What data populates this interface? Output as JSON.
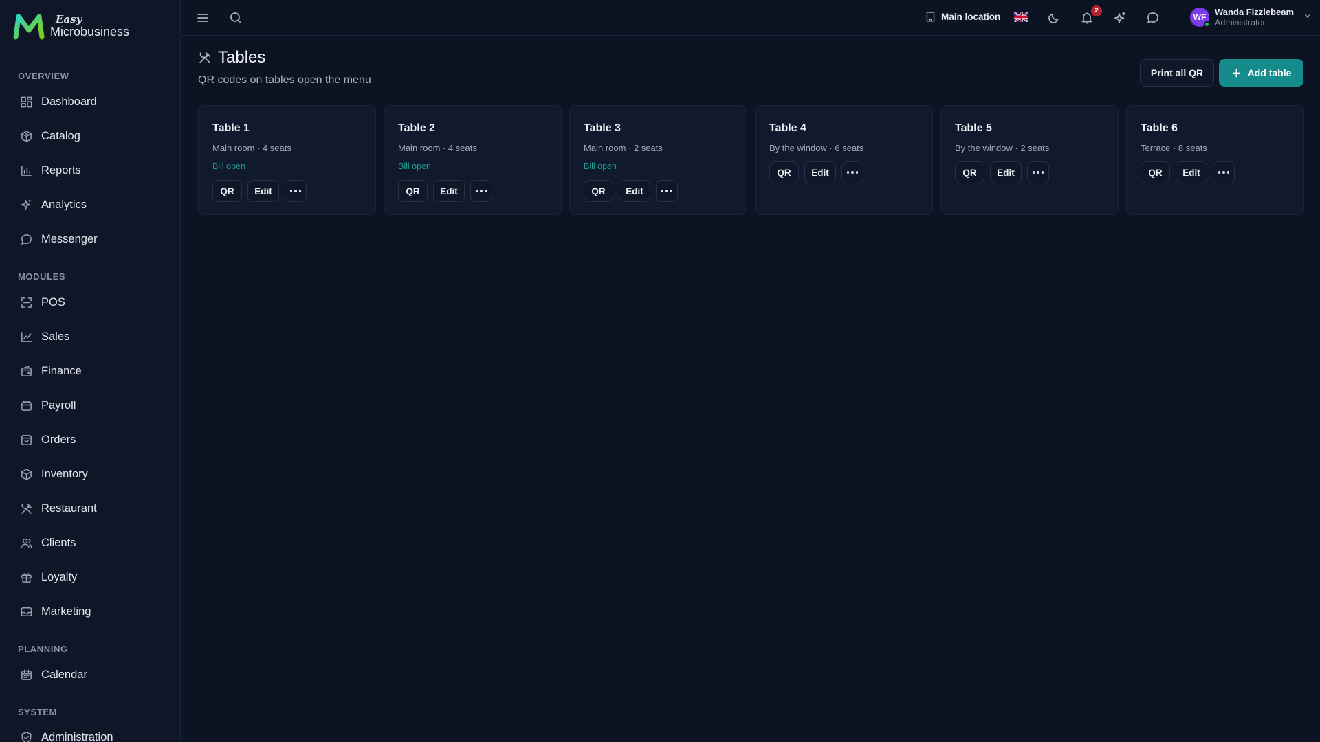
{
  "brand": {
    "easy": "Easy",
    "name": "Microbusiness"
  },
  "sidebar": {
    "sections": [
      {
        "label": "OVERVIEW",
        "items": [
          {
            "label": "Dashboard",
            "icon": "dashboard-icon"
          },
          {
            "label": "Catalog",
            "icon": "catalog-icon"
          },
          {
            "label": "Reports",
            "icon": "reports-icon"
          },
          {
            "label": "Analytics",
            "icon": "analytics-icon"
          },
          {
            "label": "Messenger",
            "icon": "messenger-icon"
          }
        ]
      },
      {
        "label": "MODULES",
        "items": [
          {
            "label": "POS",
            "icon": "pos-icon"
          },
          {
            "label": "Sales",
            "icon": "sales-icon"
          },
          {
            "label": "Finance",
            "icon": "finance-icon"
          },
          {
            "label": "Payroll",
            "icon": "payroll-icon"
          },
          {
            "label": "Orders",
            "icon": "orders-icon"
          },
          {
            "label": "Inventory",
            "icon": "inventory-icon"
          },
          {
            "label": "Restaurant",
            "icon": "restaurant-icon"
          },
          {
            "label": "Clients",
            "icon": "clients-icon"
          },
          {
            "label": "Loyalty",
            "icon": "loyalty-icon"
          },
          {
            "label": "Marketing",
            "icon": "marketing-icon"
          }
        ]
      },
      {
        "label": "PLANNING",
        "items": [
          {
            "label": "Calendar",
            "icon": "calendar-icon"
          }
        ]
      },
      {
        "label": "SYSTEM",
        "items": [
          {
            "label": "Administration",
            "icon": "administration-icon"
          }
        ]
      }
    ]
  },
  "topbar": {
    "location": "Main location",
    "notifications_count": "2",
    "user": {
      "initials": "WF",
      "name": "Wanda Fizzlebeam",
      "role": "Administrator"
    }
  },
  "page": {
    "title": "Tables",
    "subtitle": "QR codes on tables open the menu",
    "print_all_label": "Print all QR",
    "add_label": "Add table"
  },
  "tables": [
    {
      "name": "Table 1",
      "meta": "Main room · 4 seats",
      "status": "Bill open"
    },
    {
      "name": "Table 2",
      "meta": "Main room · 4 seats",
      "status": "Bill open"
    },
    {
      "name": "Table 3",
      "meta": "Main room · 2 seats",
      "status": "Bill open"
    },
    {
      "name": "Table 4",
      "meta": "By the window · 6 seats",
      "status": ""
    },
    {
      "name": "Table 5",
      "meta": "By the window · 2 seats",
      "status": ""
    },
    {
      "name": "Table 6",
      "meta": "Terrace · 8 seats",
      "status": ""
    }
  ],
  "card_actions": {
    "qr": "QR",
    "edit": "Edit"
  },
  "colors": {
    "accent": "#168b8b",
    "status_open": "#1f9c95",
    "badge": "#b4232f",
    "avatar": "#7c3aed"
  }
}
